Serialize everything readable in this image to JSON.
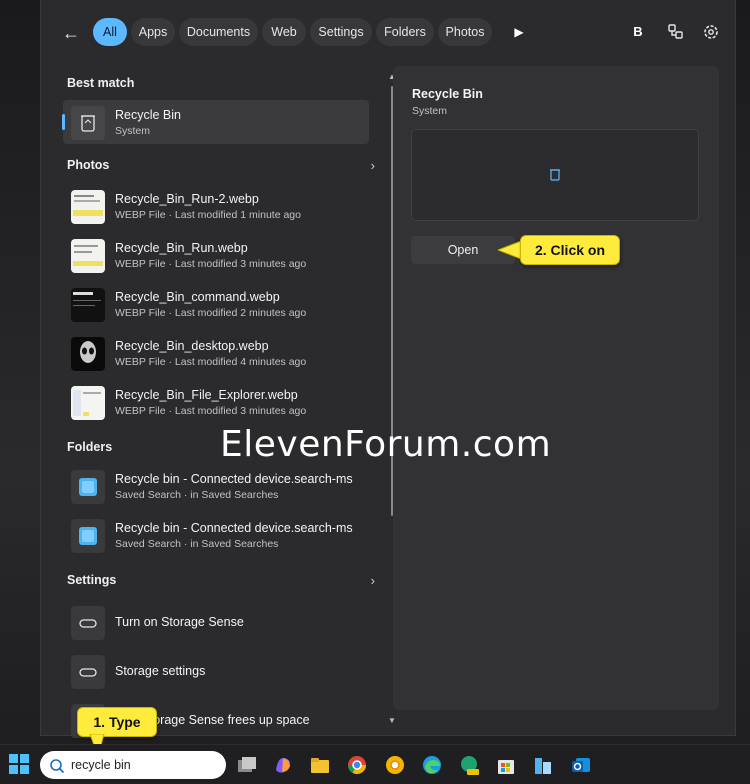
{
  "filters": {
    "items": [
      "All",
      "Apps",
      "Documents",
      "Web",
      "Settings",
      "Folders",
      "Photos"
    ],
    "active": "All",
    "account_initial": "B"
  },
  "results": {
    "best_match": {
      "heading": "Best match",
      "title": "Recycle Bin",
      "subtitle": "System"
    },
    "photos": {
      "heading": "Photos",
      "items": [
        {
          "title": "Recycle_Bin_Run-2.webp",
          "subtitle": "WEBP File · Last modified 1 minute ago"
        },
        {
          "title": "Recycle_Bin_Run.webp",
          "subtitle": "WEBP File · Last modified 3 minutes ago"
        },
        {
          "title": "Recycle_Bin_command.webp",
          "subtitle": "WEBP File · Last modified 2 minutes ago"
        },
        {
          "title": "Recycle_Bin_desktop.webp",
          "subtitle": "WEBP File · Last modified 4 minutes ago"
        },
        {
          "title": "Recycle_Bin_File_Explorer.webp",
          "subtitle": "WEBP File · Last modified 3 minutes ago"
        }
      ]
    },
    "folders": {
      "heading": "Folders",
      "items": [
        {
          "title": "Recycle bin - Connected device.search-ms",
          "subtitle": "Saved Search · in Saved Searches"
        },
        {
          "title": "Recycle bin - Connected device.search-ms",
          "subtitle": "Saved Search · in Saved Searches"
        }
      ]
    },
    "settings": {
      "heading": "Settings",
      "items": [
        {
          "title": "Turn on Storage Sense"
        },
        {
          "title": "Storage settings"
        },
        {
          "title": "how Storage Sense frees up space"
        }
      ]
    }
  },
  "preview": {
    "title": "Recycle Bin",
    "subtitle": "System",
    "open_label": "Open"
  },
  "callouts": {
    "step1": "1. Type",
    "step2": "2. Click on"
  },
  "watermark": "ElevenForum.com",
  "taskbar": {
    "search_value": "recycle bin"
  },
  "colors": {
    "accent": "#5cb8ff",
    "callout": "#ffeb3b"
  }
}
